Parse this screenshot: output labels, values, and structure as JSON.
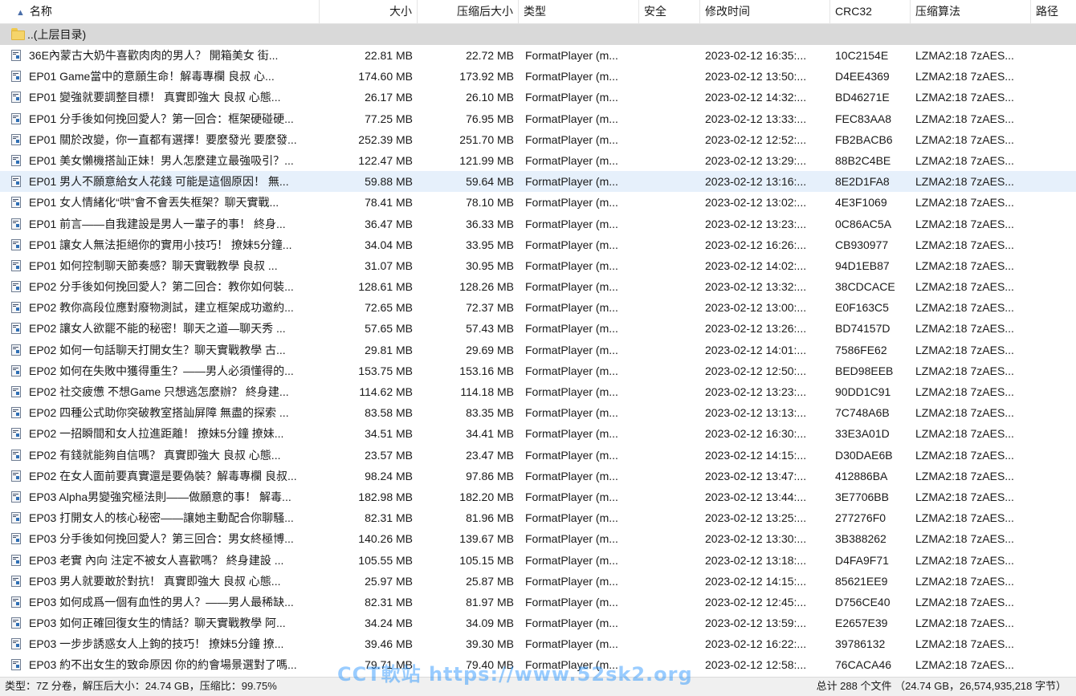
{
  "header": {
    "name": "名称",
    "size": "大小",
    "packed_size": "压缩后大小",
    "type": "类型",
    "security": "安全",
    "modified": "修改时间",
    "crc": "CRC32",
    "method": "压缩算法",
    "path": "路径"
  },
  "parent_dir": "..(上层目录)",
  "files": [
    {
      "name": "36E內蒙古大奶牛喜歡肉肉的男人？ 開箱美女 街...",
      "size": "22.81 MB",
      "packed": "22.72 MB",
      "type": "FormatPlayer (m...",
      "security": "",
      "mtime": "2023-02-12 16:35:...",
      "crc": "10C2154E",
      "method": "LZMA2:18 7zAES..."
    },
    {
      "name": "EP01 Game當中的意願生命！解毒專欄  良叔  心...",
      "size": "174.60 MB",
      "packed": "173.92 MB",
      "type": "FormatPlayer (m...",
      "security": "",
      "mtime": "2023-02-12 13:50:...",
      "crc": "D4EE4369",
      "method": "LZMA2:18 7zAES..."
    },
    {
      "name": "EP01 變強就要調整目標！ 真實即強大  良叔  心態...",
      "size": "26.17 MB",
      "packed": "26.10 MB",
      "type": "FormatPlayer (m...",
      "security": "",
      "mtime": "2023-02-12 14:32:...",
      "crc": "BD46271E",
      "method": "LZMA2:18 7zAES..."
    },
    {
      "name": "EP01 分手後如何挽回愛人？第一回合：框架硬碰硬...",
      "size": "77.25 MB",
      "packed": "76.95 MB",
      "type": "FormatPlayer (m...",
      "security": "",
      "mtime": "2023-02-12 13:33:...",
      "crc": "FEC83AA8",
      "method": "LZMA2:18 7zAES..."
    },
    {
      "name": "EP01 關於改變，你一直都有選擇！要麼發光 要麼發...",
      "size": "252.39 MB",
      "packed": "251.70 MB",
      "type": "FormatPlayer (m...",
      "security": "",
      "mtime": "2023-02-12 12:52:...",
      "crc": "FB2BACB6",
      "method": "LZMA2:18 7zAES..."
    },
    {
      "name": "EP01 美女懶機搭訕正妹！男人怎麼建立最強吸引？...",
      "size": "122.47 MB",
      "packed": "121.99 MB",
      "type": "FormatPlayer (m...",
      "security": "",
      "mtime": "2023-02-12 13:29:...",
      "crc": "88B2C4BE",
      "method": "LZMA2:18 7zAES..."
    },
    {
      "name": "EP01 男人不願意給女人花錢 可能是這個原因！ 無...",
      "size": "59.88 MB",
      "packed": "59.64 MB",
      "type": "FormatPlayer (m...",
      "security": "",
      "mtime": "2023-02-12 13:16:...",
      "crc": "8E2D1FA8",
      "method": "LZMA2:18 7zAES...",
      "selected": true
    },
    {
      "name": "EP01 女人情緒化“哄”會不會丟失框架？聊天實戰...",
      "size": "78.41 MB",
      "packed": "78.10 MB",
      "type": "FormatPlayer (m...",
      "security": "",
      "mtime": "2023-02-12 13:02:...",
      "crc": "4E3F1069",
      "method": "LZMA2:18 7zAES..."
    },
    {
      "name": "EP01 前言——自我建設是男人一輩子的事！ 終身...",
      "size": "36.47 MB",
      "packed": "36.33 MB",
      "type": "FormatPlayer (m...",
      "security": "",
      "mtime": "2023-02-12 13:23:...",
      "crc": "0C86AC5A",
      "method": "LZMA2:18 7zAES..."
    },
    {
      "name": "EP01 讓女人無法拒絕你的實用小技巧！  撩妹5分鐘...",
      "size": "34.04 MB",
      "packed": "33.95 MB",
      "type": "FormatPlayer (m...",
      "security": "",
      "mtime": "2023-02-12 16:26:...",
      "crc": "CB930977",
      "method": "LZMA2:18 7zAES..."
    },
    {
      "name": "EP01 如何控制聊天節奏感？聊天實戰教學  良叔  ...",
      "size": "31.07 MB",
      "packed": "30.95 MB",
      "type": "FormatPlayer (m...",
      "security": "",
      "mtime": "2023-02-12 14:02:...",
      "crc": "94D1EB87",
      "method": "LZMA2:18 7zAES..."
    },
    {
      "name": "EP02 分手後如何挽回愛人？第二回合：教你如何裝...",
      "size": "128.61 MB",
      "packed": "128.26 MB",
      "type": "FormatPlayer (m...",
      "security": "",
      "mtime": "2023-02-12 13:32:...",
      "crc": "38CDCACE",
      "method": "LZMA2:18 7zAES..."
    },
    {
      "name": "EP02 教你高段位應對廢物測試，建立框架成功邀約...",
      "size": "72.65 MB",
      "packed": "72.37 MB",
      "type": "FormatPlayer (m...",
      "security": "",
      "mtime": "2023-02-12 13:00:...",
      "crc": "E0F163C5",
      "method": "LZMA2:18 7zAES..."
    },
    {
      "name": "EP02 讓女人欲罷不能的秘密！聊天之道—聊天秀  ...",
      "size": "57.65 MB",
      "packed": "57.43 MB",
      "type": "FormatPlayer (m...",
      "security": "",
      "mtime": "2023-02-12 13:26:...",
      "crc": "BD74157D",
      "method": "LZMA2:18 7zAES..."
    },
    {
      "name": "EP02 如何一句話聊天打開女生？聊天實戰教學  古...",
      "size": "29.81 MB",
      "packed": "29.69 MB",
      "type": "FormatPlayer (m...",
      "security": "",
      "mtime": "2023-02-12 14:01:...",
      "crc": "7586FE62",
      "method": "LZMA2:18 7zAES..."
    },
    {
      "name": "EP02 如何在失敗中獲得重生？——男人必須懂得的...",
      "size": "153.75 MB",
      "packed": "153.16 MB",
      "type": "FormatPlayer (m...",
      "security": "",
      "mtime": "2023-02-12 12:50:...",
      "crc": "BED98EEB",
      "method": "LZMA2:18 7zAES..."
    },
    {
      "name": "EP02 社交疲憊 不想Game 只想逃怎麼辦？ 終身建...",
      "size": "114.62 MB",
      "packed": "114.18 MB",
      "type": "FormatPlayer (m...",
      "security": "",
      "mtime": "2023-02-12 13:23:...",
      "crc": "90DD1C91",
      "method": "LZMA2:18 7zAES..."
    },
    {
      "name": "EP02 四種公式助你突破教室搭訕屏障 無盡的探索  ...",
      "size": "83.58 MB",
      "packed": "83.35 MB",
      "type": "FormatPlayer (m...",
      "security": "",
      "mtime": "2023-02-12 13:13:...",
      "crc": "7C748A6B",
      "method": "LZMA2:18 7zAES..."
    },
    {
      "name": "EP02 一招瞬間和女人拉進距離！  撩妹5分鐘  撩妹...",
      "size": "34.51 MB",
      "packed": "34.41 MB",
      "type": "FormatPlayer (m...",
      "security": "",
      "mtime": "2023-02-12 16:30:...",
      "crc": "33E3A01D",
      "method": "LZMA2:18 7zAES..."
    },
    {
      "name": "EP02 有錢就能夠自信嗎？ 真實即強大  良叔  心態...",
      "size": "23.57 MB",
      "packed": "23.47 MB",
      "type": "FormatPlayer (m...",
      "security": "",
      "mtime": "2023-02-12 14:15:...",
      "crc": "D30DAE6B",
      "method": "LZMA2:18 7zAES..."
    },
    {
      "name": "EP02 在女人面前要真實還是要偽裝？解毒專欄  良叔...",
      "size": "98.24 MB",
      "packed": "97.86 MB",
      "type": "FormatPlayer (m...",
      "security": "",
      "mtime": "2023-02-12 13:47:...",
      "crc": "412886BA",
      "method": "LZMA2:18 7zAES..."
    },
    {
      "name": "EP03 Alpha男變強究極法則——做願意的事！ 解毒...",
      "size": "182.98 MB",
      "packed": "182.20 MB",
      "type": "FormatPlayer (m...",
      "security": "",
      "mtime": "2023-02-12 13:44:...",
      "crc": "3E7706BB",
      "method": "LZMA2:18 7zAES..."
    },
    {
      "name": "EP03 打開女人的核心秘密——讓她主動配合你聊騷...",
      "size": "82.31 MB",
      "packed": "81.96 MB",
      "type": "FormatPlayer (m...",
      "security": "",
      "mtime": "2023-02-12 13:25:...",
      "crc": "277276F0",
      "method": "LZMA2:18 7zAES..."
    },
    {
      "name": "EP03 分手後如何挽回愛人？第三回合：男女終極博...",
      "size": "140.26 MB",
      "packed": "139.67 MB",
      "type": "FormatPlayer (m...",
      "security": "",
      "mtime": "2023-02-12 13:30:...",
      "crc": "3B388262",
      "method": "LZMA2:18 7zAES..."
    },
    {
      "name": "EP03 老實 內向 注定不被女人喜歡嗎？ 終身建設  ...",
      "size": "105.55 MB",
      "packed": "105.15 MB",
      "type": "FormatPlayer (m...",
      "security": "",
      "mtime": "2023-02-12 13:18:...",
      "crc": "D4FA9F71",
      "method": "LZMA2:18 7zAES..."
    },
    {
      "name": "EP03 男人就要敢於對抗！ 真實即強大  良叔  心態...",
      "size": "25.97 MB",
      "packed": "25.87 MB",
      "type": "FormatPlayer (m...",
      "security": "",
      "mtime": "2023-02-12 14:15:...",
      "crc": "85621EE9",
      "method": "LZMA2:18 7zAES..."
    },
    {
      "name": "EP03 如何成爲一個有血性的男人？——男人最稀缺...",
      "size": "82.31 MB",
      "packed": "81.97 MB",
      "type": "FormatPlayer (m...",
      "security": "",
      "mtime": "2023-02-12 12:45:...",
      "crc": "D756CE40",
      "method": "LZMA2:18 7zAES..."
    },
    {
      "name": "EP03 如何正確回復女生的情話？聊天實戰教學  阿...",
      "size": "34.24 MB",
      "packed": "34.09 MB",
      "type": "FormatPlayer (m...",
      "security": "",
      "mtime": "2023-02-12 13:59:...",
      "crc": "E2657E39",
      "method": "LZMA2:18 7zAES..."
    },
    {
      "name": "EP03 一步步誘惑女人上鉤的技巧！  撩妹5分鐘  撩...",
      "size": "39.46 MB",
      "packed": "39.30 MB",
      "type": "FormatPlayer (m...",
      "security": "",
      "mtime": "2023-02-12 16:22:...",
      "crc": "39786132",
      "method": "LZMA2:18 7zAES..."
    },
    {
      "name": "EP03 約不出女生的致命原因 你的約會場景選對了嗎...",
      "size": "79.71 MB",
      "packed": "79.40 MB",
      "type": "FormatPlayer (m...",
      "security": "",
      "mtime": "2023-02-12 12:58:...",
      "crc": "76CACA46",
      "method": "LZMA2:18 7zAES..."
    }
  ],
  "status": {
    "left": "类型：7Z 分卷，解压后大小：24.74 GB，压缩比：99.75%",
    "right": "总计 288 个文件 （24.74 GB，26,574,935,218 字节）"
  },
  "watermark": "CCT軟站 https://www.52sk2.org"
}
